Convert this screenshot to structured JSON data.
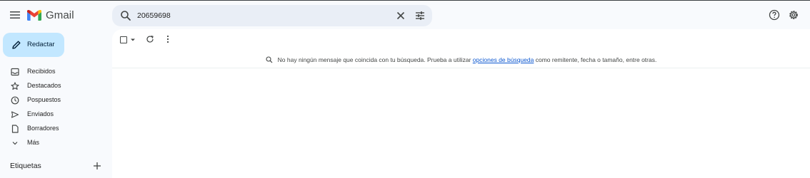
{
  "app": {
    "name": "Gmail"
  },
  "search": {
    "query": "20659698"
  },
  "compose": {
    "label": "Redactar"
  },
  "sidebar": {
    "items": [
      {
        "label": "Recibidos",
        "icon": "inbox-icon"
      },
      {
        "label": "Destacados",
        "icon": "star-icon"
      },
      {
        "label": "Pospuestos",
        "icon": "clock-icon"
      },
      {
        "label": "Enviados",
        "icon": "send-icon"
      },
      {
        "label": "Borradores",
        "icon": "draft-icon"
      },
      {
        "label": "Más",
        "icon": "chevron-down-icon"
      }
    ],
    "labels_title": "Etiquetas"
  },
  "empty_state": {
    "prefix": "No hay ningún mensaje que coincida con tu búsqueda. Prueba a utilizar",
    "link": "opciones de búsqueda",
    "suffix": "como remitente, fecha o tamaño, entre otras."
  },
  "colors": {
    "background": "#f8fafd",
    "compose": "#c2e7ff",
    "search": "#e9eef6",
    "link": "#0b57d0",
    "gmail_red": "#ea4335",
    "gmail_blue": "#4285f4",
    "gmail_green": "#34a853",
    "gmail_yellow": "#fbbc04"
  }
}
